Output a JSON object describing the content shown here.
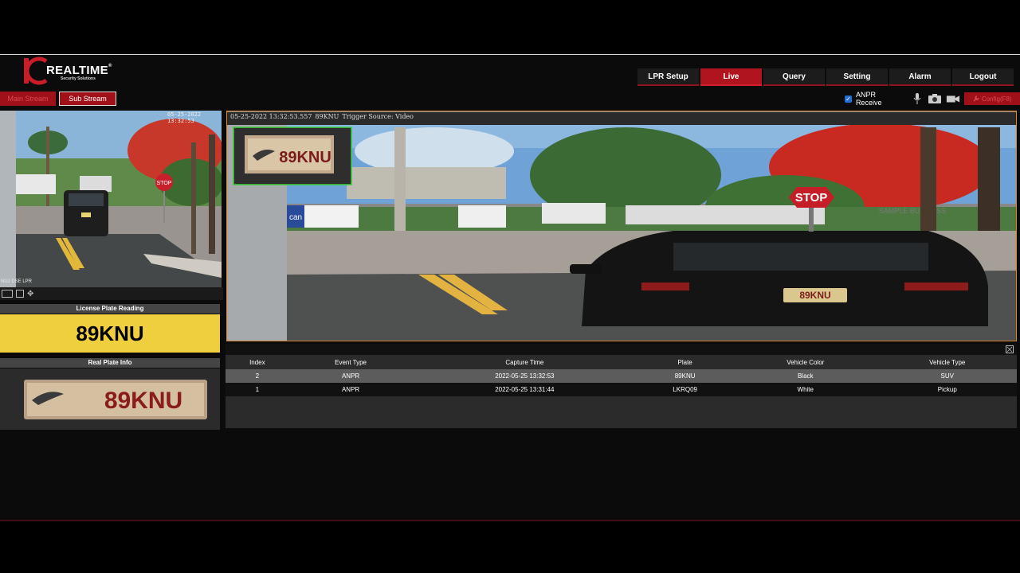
{
  "brand": {
    "name": "REALTIME",
    "registered": "®",
    "tagline": "Security Solutions",
    "accent": "#b0141f"
  },
  "nav": [
    {
      "label": "LPR Setup",
      "active": false
    },
    {
      "label": "Live",
      "active": true
    },
    {
      "label": "Query",
      "active": false
    },
    {
      "label": "Setting",
      "active": false
    },
    {
      "label": "Alarm",
      "active": false
    },
    {
      "label": "Logout",
      "active": false
    }
  ],
  "streams": {
    "main": "Main Stream",
    "sub": "Sub Stream"
  },
  "toolbar": {
    "anpr_checked": true,
    "anpr_label": "ANPR Receive",
    "icons": [
      "microphone-icon",
      "snapshot-icon",
      "record-icon"
    ],
    "config_label": "Config(F8)"
  },
  "left_camera": {
    "timestamp": "05-25-2022 13:32:53",
    "corner_text": "NUJ DSE LPR"
  },
  "license_plate": {
    "heading": "License Plate Reading",
    "value": "89KNU"
  },
  "real_plate": {
    "heading": "Real Plate Info",
    "plate_text": "89KNU"
  },
  "main_video": {
    "overlay_time": "05-25-2022 13:32:53.557",
    "overlay_plate": "89KNU",
    "overlay_trigger": "Trigger Source: Video",
    "inset_plate": "89KNU",
    "sign_text": "STOP",
    "car_plate": "89KNU",
    "truck_text": "can",
    "building_text": "SAMPLE BUSINESS"
  },
  "table": {
    "columns": [
      "Index",
      "Event Type",
      "Capture Time",
      "Plate",
      "Vehicle Color",
      "Vehicle Type"
    ],
    "rows": [
      [
        "2",
        "ANPR",
        "2022-05-25 13:32:53",
        "89KNU",
        "Black",
        "SUV"
      ],
      [
        "1",
        "ANPR",
        "2022-05-25 13:31:44",
        "LKRQ09",
        "White",
        "Pickup"
      ]
    ]
  }
}
